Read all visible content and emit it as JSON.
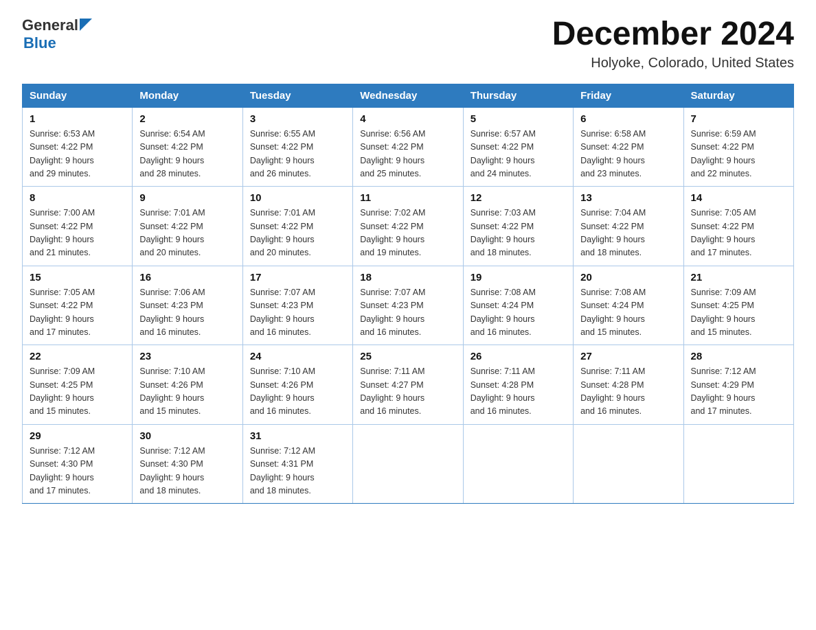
{
  "header": {
    "logo_general": "General",
    "logo_blue": "Blue",
    "title": "December 2024",
    "subtitle": "Holyoke, Colorado, United States"
  },
  "days_of_week": [
    "Sunday",
    "Monday",
    "Tuesday",
    "Wednesday",
    "Thursday",
    "Friday",
    "Saturday"
  ],
  "weeks": [
    [
      {
        "day": "1",
        "sunrise": "6:53 AM",
        "sunset": "4:22 PM",
        "daylight": "9 hours and 29 minutes."
      },
      {
        "day": "2",
        "sunrise": "6:54 AM",
        "sunset": "4:22 PM",
        "daylight": "9 hours and 28 minutes."
      },
      {
        "day": "3",
        "sunrise": "6:55 AM",
        "sunset": "4:22 PM",
        "daylight": "9 hours and 26 minutes."
      },
      {
        "day": "4",
        "sunrise": "6:56 AM",
        "sunset": "4:22 PM",
        "daylight": "9 hours and 25 minutes."
      },
      {
        "day": "5",
        "sunrise": "6:57 AM",
        "sunset": "4:22 PM",
        "daylight": "9 hours and 24 minutes."
      },
      {
        "day": "6",
        "sunrise": "6:58 AM",
        "sunset": "4:22 PM",
        "daylight": "9 hours and 23 minutes."
      },
      {
        "day": "7",
        "sunrise": "6:59 AM",
        "sunset": "4:22 PM",
        "daylight": "9 hours and 22 minutes."
      }
    ],
    [
      {
        "day": "8",
        "sunrise": "7:00 AM",
        "sunset": "4:22 PM",
        "daylight": "9 hours and 21 minutes."
      },
      {
        "day": "9",
        "sunrise": "7:01 AM",
        "sunset": "4:22 PM",
        "daylight": "9 hours and 20 minutes."
      },
      {
        "day": "10",
        "sunrise": "7:01 AM",
        "sunset": "4:22 PM",
        "daylight": "9 hours and 20 minutes."
      },
      {
        "day": "11",
        "sunrise": "7:02 AM",
        "sunset": "4:22 PM",
        "daylight": "9 hours and 19 minutes."
      },
      {
        "day": "12",
        "sunrise": "7:03 AM",
        "sunset": "4:22 PM",
        "daylight": "9 hours and 18 minutes."
      },
      {
        "day": "13",
        "sunrise": "7:04 AM",
        "sunset": "4:22 PM",
        "daylight": "9 hours and 18 minutes."
      },
      {
        "day": "14",
        "sunrise": "7:05 AM",
        "sunset": "4:22 PM",
        "daylight": "9 hours and 17 minutes."
      }
    ],
    [
      {
        "day": "15",
        "sunrise": "7:05 AM",
        "sunset": "4:22 PM",
        "daylight": "9 hours and 17 minutes."
      },
      {
        "day": "16",
        "sunrise": "7:06 AM",
        "sunset": "4:23 PM",
        "daylight": "9 hours and 16 minutes."
      },
      {
        "day": "17",
        "sunrise": "7:07 AM",
        "sunset": "4:23 PM",
        "daylight": "9 hours and 16 minutes."
      },
      {
        "day": "18",
        "sunrise": "7:07 AM",
        "sunset": "4:23 PM",
        "daylight": "9 hours and 16 minutes."
      },
      {
        "day": "19",
        "sunrise": "7:08 AM",
        "sunset": "4:24 PM",
        "daylight": "9 hours and 16 minutes."
      },
      {
        "day": "20",
        "sunrise": "7:08 AM",
        "sunset": "4:24 PM",
        "daylight": "9 hours and 15 minutes."
      },
      {
        "day": "21",
        "sunrise": "7:09 AM",
        "sunset": "4:25 PM",
        "daylight": "9 hours and 15 minutes."
      }
    ],
    [
      {
        "day": "22",
        "sunrise": "7:09 AM",
        "sunset": "4:25 PM",
        "daylight": "9 hours and 15 minutes."
      },
      {
        "day": "23",
        "sunrise": "7:10 AM",
        "sunset": "4:26 PM",
        "daylight": "9 hours and 15 minutes."
      },
      {
        "day": "24",
        "sunrise": "7:10 AM",
        "sunset": "4:26 PM",
        "daylight": "9 hours and 16 minutes."
      },
      {
        "day": "25",
        "sunrise": "7:11 AM",
        "sunset": "4:27 PM",
        "daylight": "9 hours and 16 minutes."
      },
      {
        "day": "26",
        "sunrise": "7:11 AM",
        "sunset": "4:28 PM",
        "daylight": "9 hours and 16 minutes."
      },
      {
        "day": "27",
        "sunrise": "7:11 AM",
        "sunset": "4:28 PM",
        "daylight": "9 hours and 16 minutes."
      },
      {
        "day": "28",
        "sunrise": "7:12 AM",
        "sunset": "4:29 PM",
        "daylight": "9 hours and 17 minutes."
      }
    ],
    [
      {
        "day": "29",
        "sunrise": "7:12 AM",
        "sunset": "4:30 PM",
        "daylight": "9 hours and 17 minutes."
      },
      {
        "day": "30",
        "sunrise": "7:12 AM",
        "sunset": "4:30 PM",
        "daylight": "9 hours and 18 minutes."
      },
      {
        "day": "31",
        "sunrise": "7:12 AM",
        "sunset": "4:31 PM",
        "daylight": "9 hours and 18 minutes."
      },
      null,
      null,
      null,
      null
    ]
  ],
  "labels": {
    "sunrise": "Sunrise:",
    "sunset": "Sunset:",
    "daylight": "Daylight:"
  }
}
